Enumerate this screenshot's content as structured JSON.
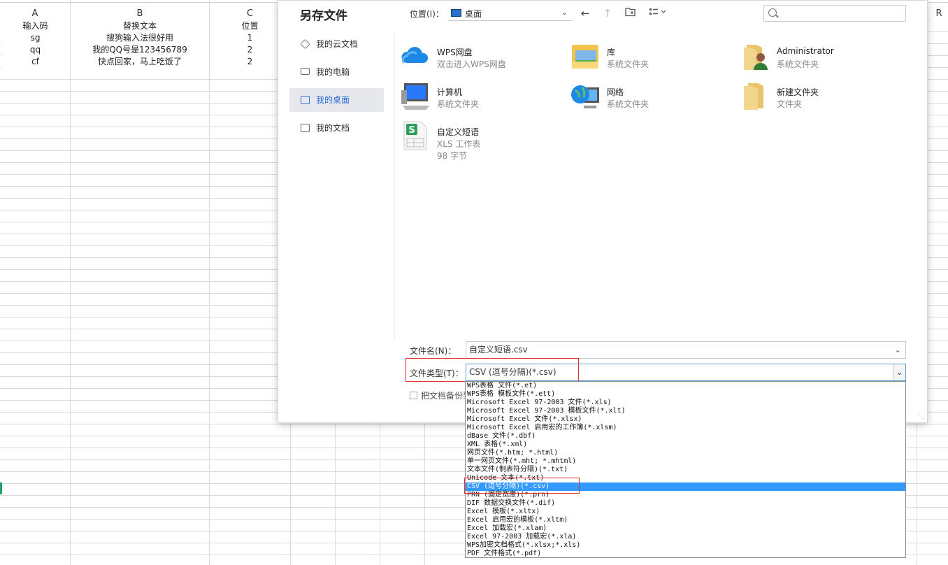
{
  "spreadsheet": {
    "columns": {
      "A": "A",
      "B": "B",
      "C": "C",
      "R": "R"
    },
    "rows": [
      {
        "a": "输入码",
        "b": "替换文本",
        "c": "位置"
      },
      {
        "a": "sg",
        "b": "搜狗输入法很好用",
        "c": "1"
      },
      {
        "a": "qq",
        "b": "我的QQ号是123456789",
        "c": "2"
      },
      {
        "a": "cf",
        "b": "快点回家，马上吃饭了",
        "c": "2"
      }
    ]
  },
  "dialog": {
    "title": "另存文件",
    "location_label": "位置(I)：",
    "location_value": "桌面",
    "search_placeholder": "",
    "sidebar": [
      {
        "label": "我的云文档",
        "icon": "cube-icon"
      },
      {
        "label": "我的电脑",
        "icon": "monitor-icon"
      },
      {
        "label": "我的桌面",
        "icon": "desktop-icon",
        "active": true
      },
      {
        "label": "我的文档",
        "icon": "folder-icon"
      }
    ],
    "files": [
      {
        "name": "WPS网盘",
        "sub": "双击进入WPS网盘",
        "icon": "cloud-icon"
      },
      {
        "name": "库",
        "sub": "系统文件夹",
        "icon": "library-icon"
      },
      {
        "name": "Administrator",
        "sub": "系统文件夹",
        "icon": "user-folder-icon"
      },
      {
        "name": "计算机",
        "sub": "系统文件夹",
        "icon": "computer-icon"
      },
      {
        "name": "网络",
        "sub": "系统文件夹",
        "icon": "network-globe-icon"
      },
      {
        "name": "新建文件夹",
        "sub": "文件夹",
        "icon": "folder-icon"
      },
      {
        "name": "自定义短语",
        "sub": "XLS 工作表",
        "sub2": "98 字节",
        "icon": "spreadsheet-file-icon"
      }
    ],
    "filename_label": "文件名(N)：",
    "filename_value": "自定义短语.csv",
    "filetype_label": "文件类型(T)：",
    "filetype_value": "CSV (逗号分隔)(*.csv)",
    "backup_label": "把文档备份到"
  },
  "dropdown": {
    "items": [
      "WPS表格 文件(*.et)",
      "WPS表格 模板文件(*.ett)",
      "Microsoft Excel 97-2003 文件(*.xls)",
      "Microsoft Excel 97-2003 模板文件(*.xlt)",
      "Microsoft Excel 文件(*.xlsx)",
      "Microsoft Excel 启用宏的工作簿(*.xlsm)",
      "dBase 文件(*.dbf)",
      "XML 表格(*.xml)",
      "网页文件(*.htm; *.html)",
      "单一网页文件(*.mht; *.mhtml)",
      "文本文件(制表符分隔)(*.txt)",
      "Unicode 文本(*.txt)",
      "CSV (逗号分隔)(*.csv)",
      "PRN (固定宽度)(*.prn)",
      "DIF 数据交换文件(*.dif)",
      "Excel 模板(*.xltx)",
      "Excel 启用宏的模板(*.xltm)",
      "Excel 加载宏(*.xlam)",
      "Excel 97-2003 加载宏(*.xla)",
      "WPS加密文档格式(*.xlsx;*.xls)",
      "PDF 文件格式(*.pdf)"
    ],
    "selected_index": 12
  },
  "colors": {
    "accent": "#2f6fd7",
    "selection": "#3399ff",
    "highlight_box": "#e0312f"
  }
}
